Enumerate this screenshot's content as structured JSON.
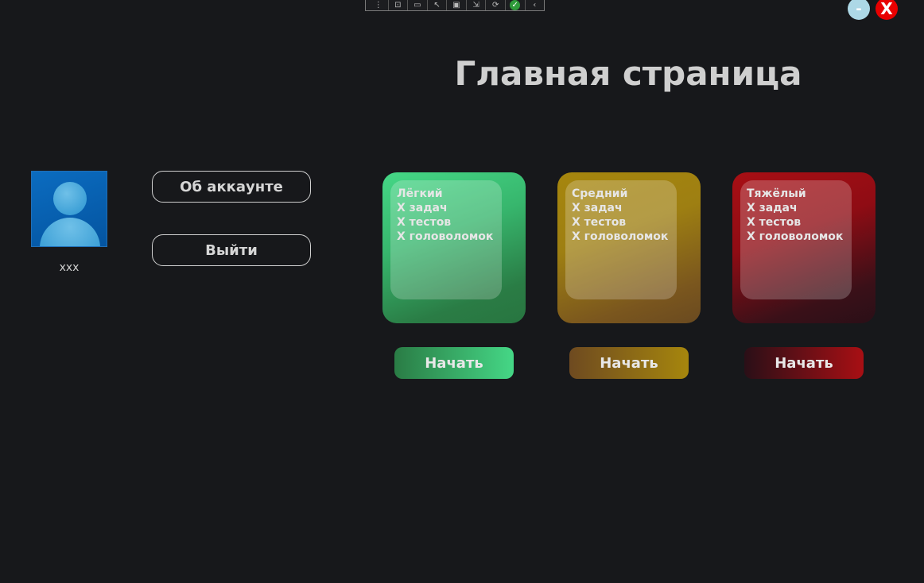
{
  "toolbar": {
    "items": [
      {
        "icon": "grip-icon",
        "glyph": "⋮"
      },
      {
        "icon": "select-element-icon",
        "glyph": "⊡"
      },
      {
        "icon": "video-icon",
        "glyph": "▭"
      },
      {
        "icon": "pointer-icon",
        "glyph": "↖"
      },
      {
        "icon": "layout-icon",
        "glyph": "▣"
      },
      {
        "icon": "track-focus-icon",
        "glyph": "⇲"
      },
      {
        "icon": "hot-reload-icon",
        "glyph": "⟳"
      },
      {
        "icon": "check-icon",
        "glyph": "✓"
      },
      {
        "icon": "collapse-icon",
        "glyph": "‹"
      }
    ]
  },
  "window": {
    "minimize_label": "-",
    "close_label": "X"
  },
  "page": {
    "title": "Главная страница"
  },
  "user": {
    "name": "xxx",
    "avatar_icon": "user-avatar-icon"
  },
  "side_buttons": {
    "account_label": "Об аккаунте",
    "logout_label": "Выйти"
  },
  "levels": [
    {
      "name": "Лёгкий",
      "tasks": "X задач",
      "tests": "X тестов",
      "puzzles": "X головоломок",
      "start_label": "Начать",
      "color": "#45d786"
    },
    {
      "name": "Средний",
      "tasks": "X задач",
      "tests": "X тестов",
      "puzzles": "X головоломок",
      "start_label": "Начать",
      "color": "#a6860d"
    },
    {
      "name": "Тяжёлый",
      "tasks": "X задач",
      "tests": "X тестов",
      "puzzles": "X головоломок",
      "start_label": "Начать",
      "color": "#a80f14"
    }
  ]
}
